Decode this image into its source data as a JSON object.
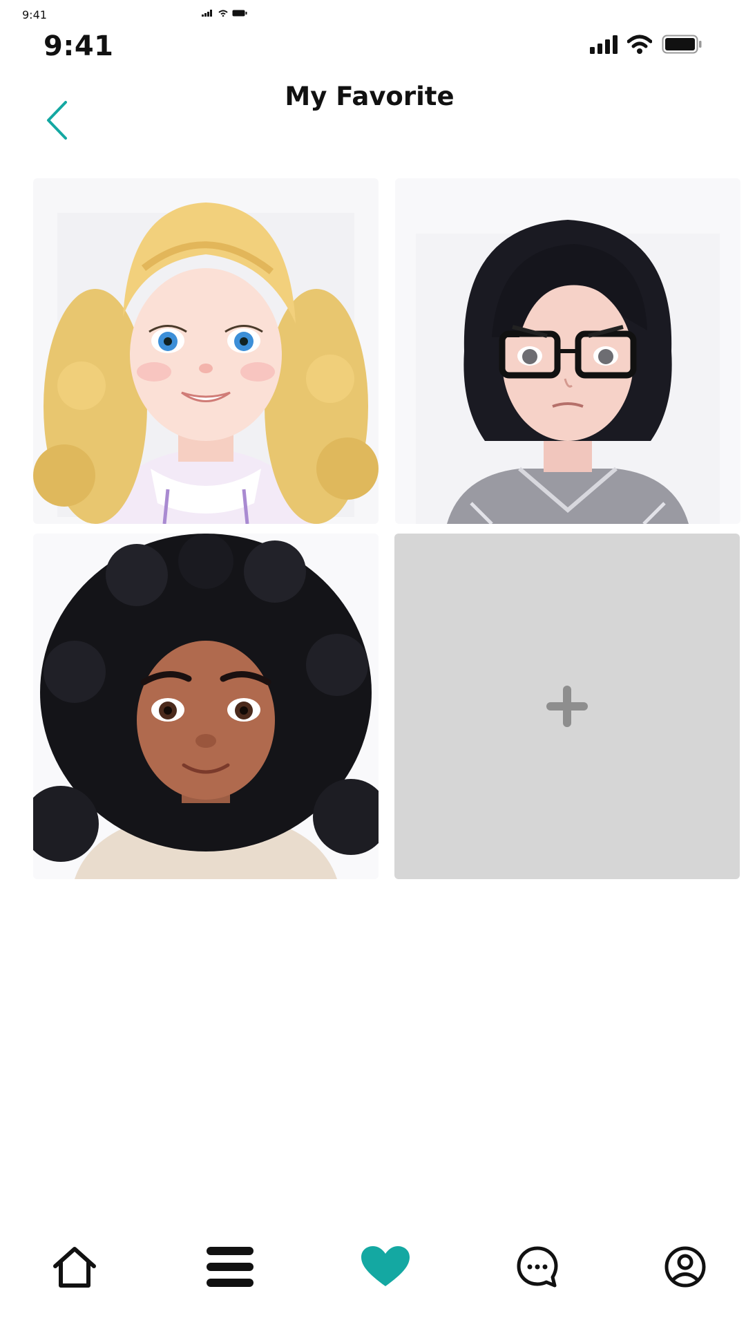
{
  "status_bar": {
    "mini_time": "9:41",
    "time": "9:41"
  },
  "header": {
    "title": "My Favorite",
    "back_icon": "chevron-left-icon"
  },
  "favorites": [
    {
      "description": "avatar-blonde-curly"
    },
    {
      "description": "avatar-black-bob-glasses"
    },
    {
      "description": "avatar-black-curly"
    }
  ],
  "add_tile": {
    "icon": "plus-icon"
  },
  "tab_bar": {
    "items": [
      {
        "icon": "home-icon"
      },
      {
        "icon": "menu-icon"
      },
      {
        "icon": "heart-icon",
        "active": true
      },
      {
        "icon": "chat-icon"
      },
      {
        "icon": "profile-icon"
      }
    ]
  },
  "colors": {
    "accent": "#14a8a2",
    "add_tile_bg": "#d6d6d6",
    "plus": "#8e8e8e",
    "text": "#111111"
  }
}
